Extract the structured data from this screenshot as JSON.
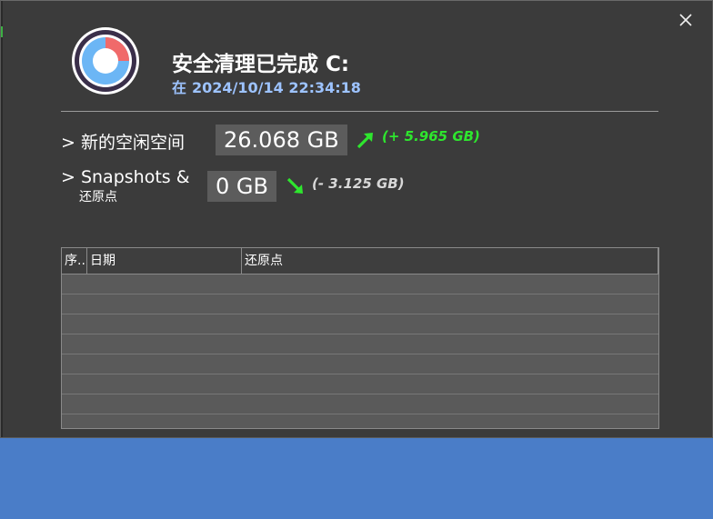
{
  "header": {
    "title": "安全清理已完成 C:",
    "subtitle_prefix": "在",
    "subtitle_datetime": "2024/10/14 22:34:18"
  },
  "stats": [
    {
      "label": "> 新的空闲空间",
      "value": "26.068 GB",
      "delta": "(+ 5.965 GB)",
      "delta_color": "#2ee62e",
      "arrow": "arrow-up-right-icon"
    },
    {
      "label": "> Snapshots &",
      "label_sub": "还原点",
      "value": "0 GB",
      "delta": "(- 3.125 GB)",
      "delta_color": "#d8d8d8",
      "arrow": "arrow-down-right-icon"
    }
  ],
  "table": {
    "columns": [
      "序..",
      "日期",
      "还原点"
    ],
    "rows": [
      "",
      "",
      "",
      "",
      "",
      "",
      "",
      ""
    ]
  },
  "close_icon": "close-icon"
}
